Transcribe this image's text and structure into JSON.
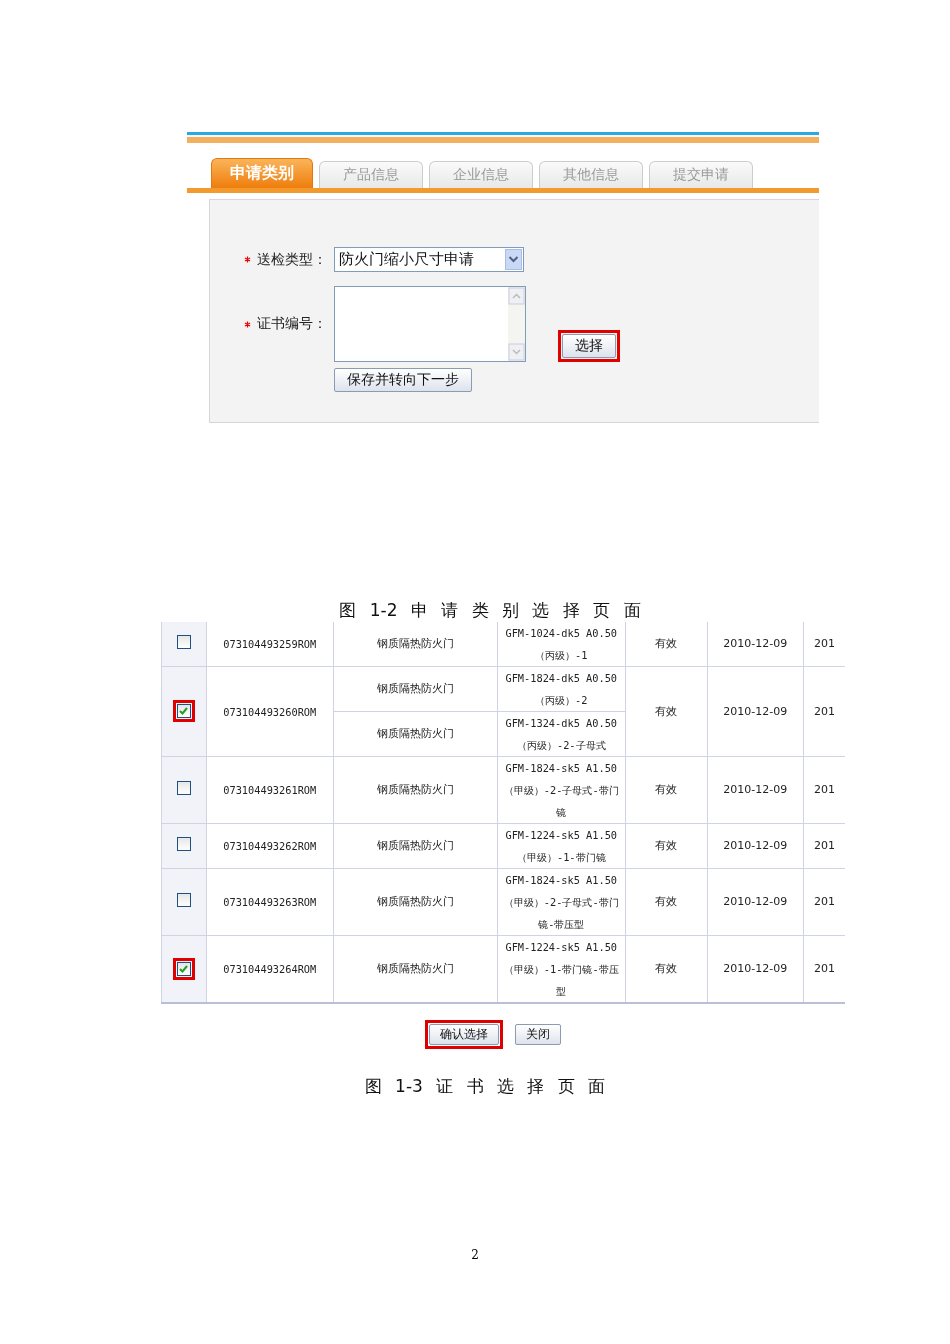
{
  "figure_1": {
    "tabs": [
      {
        "label": "申请类别",
        "selected": true
      },
      {
        "label": "产品信息",
        "selected": false
      },
      {
        "label": "企业信息",
        "selected": false
      },
      {
        "label": "其他信息",
        "selected": false
      },
      {
        "label": "提交申请",
        "selected": false
      }
    ],
    "fields": [
      {
        "kind": "select",
        "label": "送检类型：",
        "required": true,
        "value": "防火门缩小尺寸申请"
      },
      {
        "kind": "textarea",
        "label": "证书编号：",
        "required": true
      }
    ],
    "select_button": {
      "label": "选择",
      "highlighted": true
    },
    "save_button": {
      "label": "保存并转向下一步"
    },
    "caption": "图 1-2 申 请 类 别 选 择 页 面"
  },
  "figure_2": {
    "rows": [
      {
        "checked": false,
        "highlighted": false,
        "certificate": "073104493259ROM",
        "items": [
          {
            "name": "钢质隔热防火门",
            "model": "GFM-1024-dk5 A0.50（丙级）-1"
          }
        ],
        "status": "有效",
        "date": "2010-12-09",
        "column_7": "201"
      },
      {
        "checked": true,
        "highlighted": true,
        "certificate": "073104493260ROM",
        "items": [
          {
            "name": "钢质隔热防火门",
            "model": "GFM-1824-dk5 A0.50（丙级）-2"
          },
          {
            "name": "钢质隔热防火门",
            "model": "GFM-1324-dk5 A0.50（丙级）-2-子母式"
          }
        ],
        "status": "有效",
        "date": "2010-12-09",
        "column_7": "201"
      },
      {
        "checked": false,
        "highlighted": false,
        "certificate": "073104493261ROM",
        "items": [
          {
            "name": "钢质隔热防火门",
            "model": "GFM-1824-sk5 A1.50（甲级）-2-子母式-带门镜"
          }
        ],
        "status": "有效",
        "date": "2010-12-09",
        "column_7": "201"
      },
      {
        "checked": false,
        "highlighted": false,
        "certificate": "073104493262ROM",
        "items": [
          {
            "name": "钢质隔热防火门",
            "model": "GFM-1224-sk5 A1.50（甲级）-1-带门镜"
          }
        ],
        "status": "有效",
        "date": "2010-12-09",
        "column_7": "201"
      },
      {
        "checked": false,
        "highlighted": false,
        "certificate": "073104493263ROM",
        "items": [
          {
            "name": "钢质隔热防火门",
            "model": "GFM-1824-sk5 A1.50（甲级）-2-子母式-带门镜-带压型"
          }
        ],
        "status": "有效",
        "date": "2010-12-09",
        "column_7": "201"
      },
      {
        "checked": true,
        "highlighted": true,
        "certificate": "073104493264ROM",
        "items": [
          {
            "name": "钢质隔热防火门",
            "model": "GFM-1224-sk5 A1.50（甲级）-1-带门镜-带压型"
          }
        ],
        "status": "有效",
        "date": "2010-12-09",
        "column_7": "201"
      }
    ],
    "buttons": [
      {
        "label": "确认选择",
        "highlighted": true
      },
      {
        "label": "关闭",
        "highlighted": false
      }
    ],
    "caption": "图 1-3 证 书 选 择 页 面"
  },
  "page_number": "2"
}
